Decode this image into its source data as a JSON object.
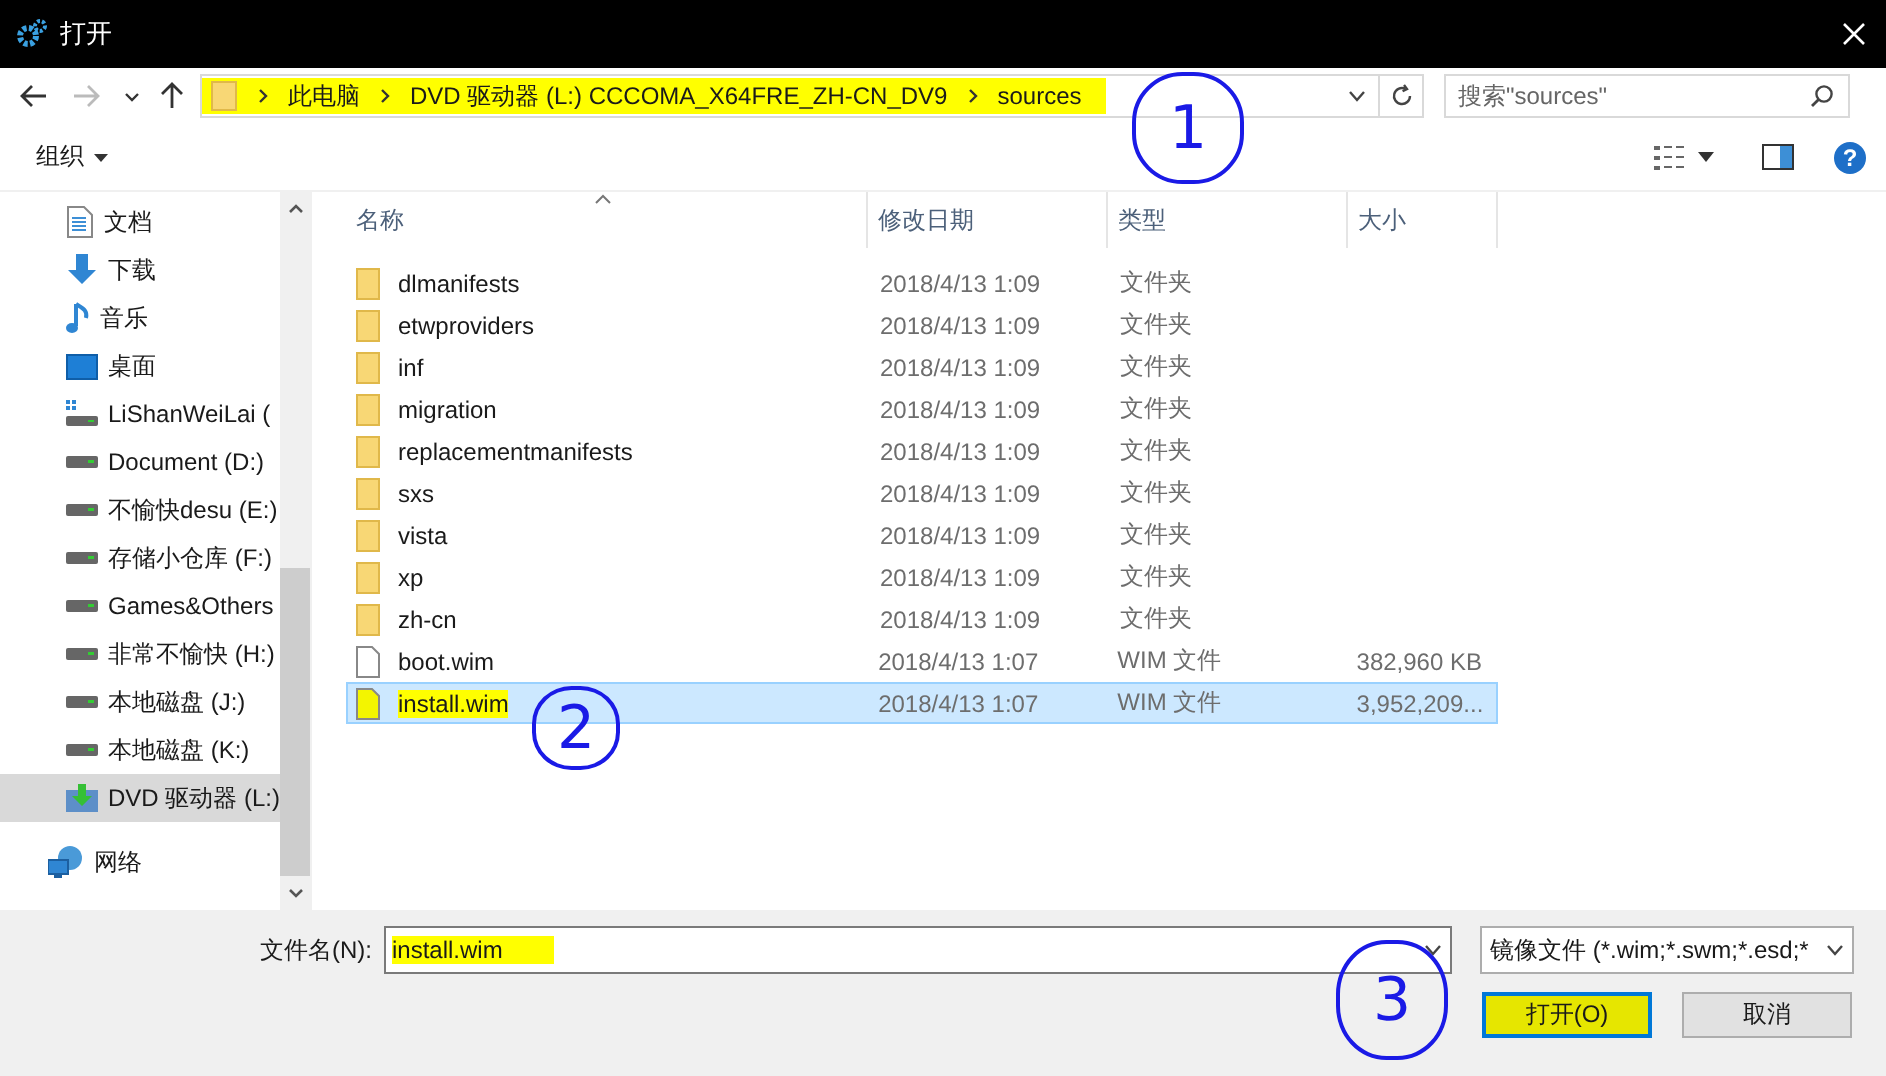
{
  "window": {
    "title": "打开"
  },
  "nav_buttons": [
    {
      "kind": "back",
      "disabled": false
    },
    {
      "kind": "forward",
      "disabled": true
    },
    {
      "kind": "recent",
      "disabled": false
    },
    {
      "kind": "up",
      "disabled": false
    }
  ],
  "address": {
    "highlighted": true,
    "crumbs": [
      "此电脑",
      "DVD 驱动器 (L:) CCCOMA_X64FRE_ZH-CN_DV9",
      "sources"
    ]
  },
  "search": {
    "placeholder": "搜索\"sources\""
  },
  "toolbar": {
    "organize": "组织",
    "help": "?"
  },
  "sidebar": {
    "items": [
      {
        "label": "文档",
        "kind": "documents",
        "selected": false
      },
      {
        "label": "下载",
        "kind": "downloads",
        "selected": false
      },
      {
        "label": "音乐",
        "kind": "music",
        "selected": false
      },
      {
        "label": "桌面",
        "kind": "desktop",
        "selected": false
      },
      {
        "label": "LiShanWeiLai (",
        "kind": "system-drive",
        "selected": false
      },
      {
        "label": "Document (D:)",
        "kind": "drive",
        "selected": false
      },
      {
        "label": "不愉快desu (E:)",
        "kind": "drive",
        "selected": false
      },
      {
        "label": "存储小仓库 (F:)",
        "kind": "drive",
        "selected": false
      },
      {
        "label": "Games&Others",
        "kind": "drive",
        "selected": false
      },
      {
        "label": "非常不愉快 (H:)",
        "kind": "drive",
        "selected": false
      },
      {
        "label": "本地磁盘 (J:)",
        "kind": "drive",
        "selected": false
      },
      {
        "label": "本地磁盘 (K:)",
        "kind": "drive",
        "selected": false
      },
      {
        "label": "DVD 驱动器 (L:)",
        "kind": "dvd",
        "selected": true
      },
      {
        "label": "网络",
        "kind": "network",
        "selected": false
      }
    ]
  },
  "table": {
    "columns": [
      "名称",
      "修改日期",
      "类型",
      "大小"
    ],
    "rows": [
      {
        "kind": "folder",
        "name": "dlmanifests",
        "date": "2018/4/13 1:09",
        "type": "文件夹",
        "selected": false,
        "highlighted": false
      },
      {
        "kind": "folder",
        "name": "etwproviders",
        "date": "2018/4/13 1:09",
        "type": "文件夹",
        "selected": false,
        "highlighted": false
      },
      {
        "kind": "folder",
        "name": "inf",
        "date": "2018/4/13 1:09",
        "type": "文件夹",
        "selected": false,
        "highlighted": false
      },
      {
        "kind": "folder",
        "name": "migration",
        "date": "2018/4/13 1:09",
        "type": "文件夹",
        "selected": false,
        "highlighted": false
      },
      {
        "kind": "folder",
        "name": "replacementmanifests",
        "date": "2018/4/13 1:09",
        "type": "文件夹",
        "selected": false,
        "highlighted": false
      },
      {
        "kind": "folder",
        "name": "sxs",
        "date": "2018/4/13 1:09",
        "type": "文件夹",
        "selected": false,
        "highlighted": false
      },
      {
        "kind": "folder",
        "name": "vista",
        "date": "2018/4/13 1:09",
        "type": "文件夹",
        "selected": false,
        "highlighted": false
      },
      {
        "kind": "folder",
        "name": "xp",
        "date": "2018/4/13 1:09",
        "type": "文件夹",
        "selected": false,
        "highlighted": false
      },
      {
        "kind": "folder",
        "name": "zh-cn",
        "date": "2018/4/13 1:09",
        "type": "文件夹",
        "selected": false,
        "highlighted": false
      },
      {
        "kind": "file",
        "name": "boot.wim",
        "date": "2018/4/13 1:07",
        "type": "WIM 文件",
        "size": "382,960 KB",
        "selected": false,
        "highlighted": false
      },
      {
        "kind": "file",
        "name": "install.wim",
        "date": "2018/4/13 1:07",
        "type": "WIM 文件",
        "size": "3,952,209...",
        "selected": true,
        "highlighted": true
      }
    ]
  },
  "filename": {
    "label": "文件名(N):",
    "value": "install.wim",
    "highlighted": true
  },
  "filetype": {
    "value": "镜像文件 (*.wim;*.swm;*.esd;*"
  },
  "buttons": [
    {
      "label": "打开(O)",
      "kind": "primary",
      "highlighted": true
    },
    {
      "label": "取消",
      "kind": "secondary",
      "highlighted": false
    }
  ],
  "annotations": [
    "1",
    "2",
    "3"
  ]
}
